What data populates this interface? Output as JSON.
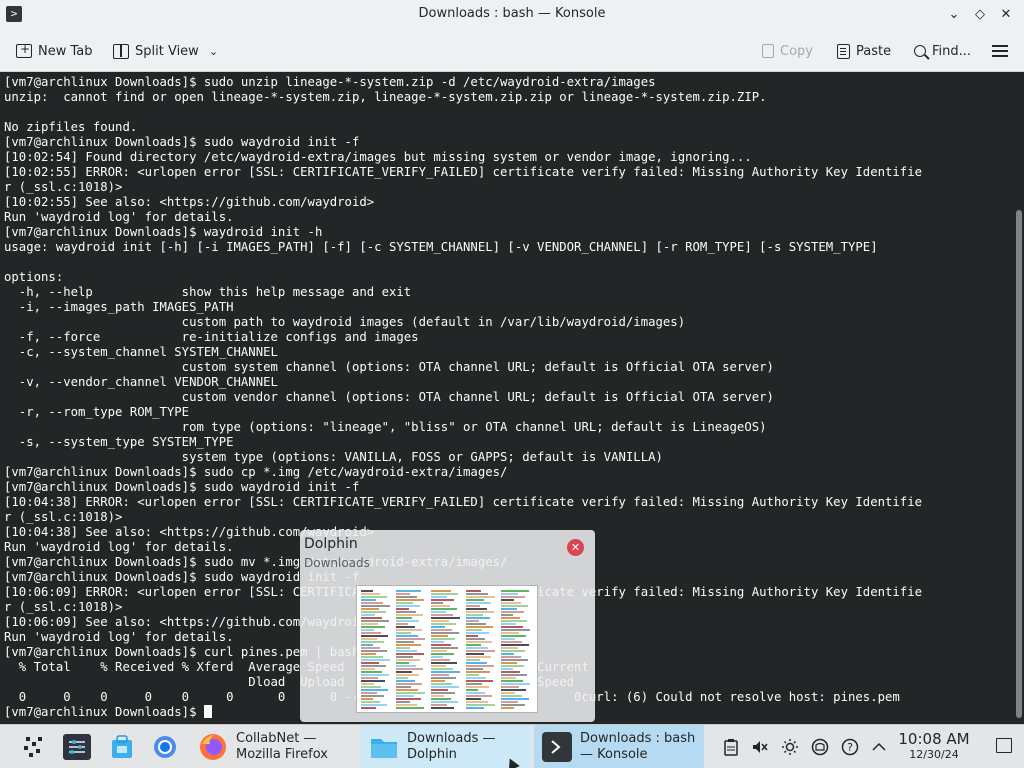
{
  "window": {
    "title": "Downloads : bash — Konsole",
    "app_icon": "terminal-icon",
    "controls": [
      "chevron-down-icon",
      "diamond-icon",
      "close-icon"
    ]
  },
  "toolbar": {
    "new_tab": "New Tab",
    "split_view": "Split View",
    "copy": "Copy",
    "paste": "Paste",
    "find": "Find...",
    "menu_icon": "hamburger-menu-icon"
  },
  "terminal": {
    "lines": [
      "[vm7@archlinux Downloads]$ sudo unzip lineage-*-system.zip -d /etc/waydroid-extra/images",
      "unzip:  cannot find or open lineage-*-system.zip, lineage-*-system.zip.zip or lineage-*-system.zip.ZIP.",
      "",
      "No zipfiles found.",
      "[vm7@archlinux Downloads]$ sudo waydroid init -f",
      "[10:02:54] Found directory /etc/waydroid-extra/images but missing system or vendor image, ignoring...",
      "[10:02:55] ERROR: <urlopen error [SSL: CERTIFICATE_VERIFY_FAILED] certificate verify failed: Missing Authority Key Identifie",
      "r (_ssl.c:1018)>",
      "[10:02:55] See also: <https://github.com/waydroid>",
      "Run 'waydroid log' for details.",
      "[vm7@archlinux Downloads]$ waydroid init -h",
      "usage: waydroid init [-h] [-i IMAGES_PATH] [-f] [-c SYSTEM_CHANNEL] [-v VENDOR_CHANNEL] [-r ROM_TYPE] [-s SYSTEM_TYPE]",
      "",
      "options:",
      "  -h, --help            show this help message and exit",
      "  -i, --images_path IMAGES_PATH",
      "                        custom path to waydroid images (default in /var/lib/waydroid/images)",
      "  -f, --force           re-initialize configs and images",
      "  -c, --system_channel SYSTEM_CHANNEL",
      "                        custom system channel (options: OTA channel URL; default is Official OTA server)",
      "  -v, --vendor_channel VENDOR_CHANNEL",
      "                        custom vendor channel (options: OTA channel URL; default is Official OTA server)",
      "  -r, --rom_type ROM_TYPE",
      "                        rom type (options: \"lineage\", \"bliss\" or OTA channel URL; default is LineageOS)",
      "  -s, --system_type SYSTEM_TYPE",
      "                        system type (options: VANILLA, FOSS or GAPPS; default is VANILLA)",
      "[vm7@archlinux Downloads]$ sudo cp *.img /etc/waydroid-extra/images/",
      "[vm7@archlinux Downloads]$ sudo waydroid init -f",
      "[10:04:38] ERROR: <urlopen error [SSL: CERTIFICATE_VERIFY_FAILED] certificate verify failed: Missing Authority Key Identifie",
      "r (_ssl.c:1018)>",
      "[10:04:38] See also: <https://github.com/waydroid>",
      "Run 'waydroid log' for details.",
      "[vm7@archlinux Downloads]$ sudo mv *.img /etc/waydroid-extra/images/",
      "[vm7@archlinux Downloads]$ sudo waydroid init -f",
      "[10:06:09] ERROR: <urlopen error [SSL: CERTIFICATE_VERIFY_FAILED] certificate verify failed: Missing Authority Key Identifie",
      "r (_ssl.c:1018)>",
      "[10:06:09] See also: <https://github.com/waydroid>",
      "Run 'waydroid log' for details.",
      "[vm7@archlinux Downloads]$ curl pines.pem | bash",
      "  % Total    % Received % Xferd  Average Speed   Time    Time     Time  Current",
      "                                 Dload  Upload   Total   Spent    Left  Speed",
      "  0     0    0     0    0     0      0      0 --:--:-- --:--:-- --:--:--     0curl: (6) Could not resolve host: pines.pem",
      "[vm7@archlinux Downloads]$ "
    ]
  },
  "preview": {
    "title": "Dolphin",
    "subtitle": "Downloads"
  },
  "taskbar": {
    "launchers": [
      {
        "name": "app-launcher-icon",
        "color": "#232629"
      },
      {
        "name": "system-settings-icon",
        "color": "#2e3440"
      },
      {
        "name": "discover-icon",
        "color": "#3daee9"
      },
      {
        "name": "chromium-icon",
        "color": "#4a8af4"
      }
    ],
    "tasks": [
      {
        "line1": "CollabNet —",
        "line2": "Mozilla Firefox",
        "icon": "firefox-icon"
      },
      {
        "line1": "Downloads —",
        "line2": "Dolphin",
        "icon": "folder-icon"
      },
      {
        "line1": "Downloads : bash",
        "line2": "— Konsole",
        "icon": "terminal-icon"
      }
    ],
    "tray": [
      "clipboard-icon",
      "volume-muted-icon",
      "brightness-icon",
      "network-icon",
      "help-icon",
      "chevron-up-icon"
    ],
    "clock": {
      "time": "10:08 AM",
      "date": "12/30/24"
    }
  },
  "colors": {
    "terminal_bg": "#232627",
    "terminal_fg": "#fcfcfc",
    "active_task": "#b5daf1",
    "accent": "#3daee9",
    "close_red": "#da4453"
  }
}
